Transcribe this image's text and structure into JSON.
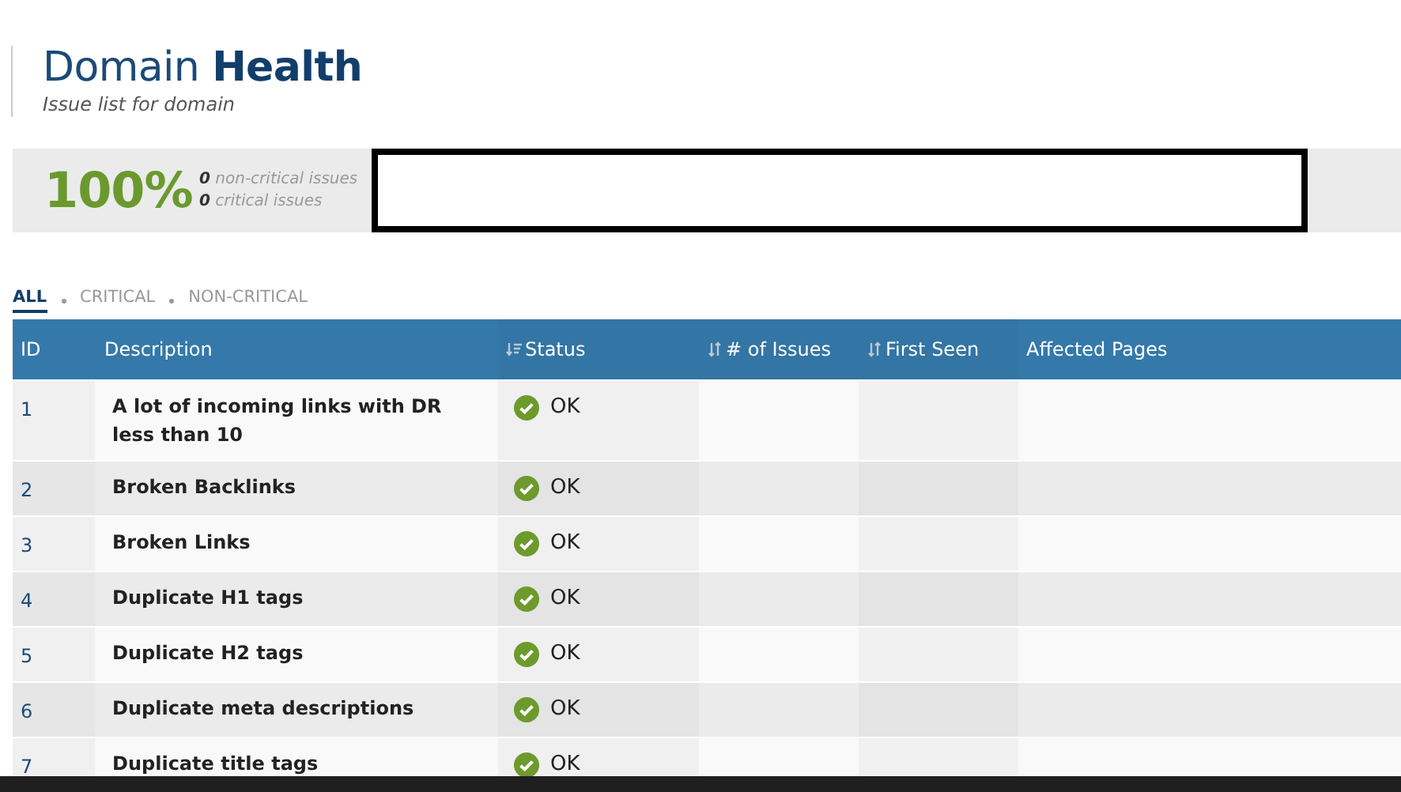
{
  "header": {
    "title_light": "Domain",
    "title_bold": "Health",
    "subtitle": "Issue list for domain"
  },
  "summary": {
    "score": "100%",
    "lines": [
      "**0** non-critical issues",
      "**0** critical issues"
    ]
  },
  "tabs": [
    {
      "label": "ALL",
      "selected": true
    },
    {
      "label": "CRITICAL",
      "selected": false
    },
    {
      "label": "NON-CRITICAL",
      "selected": false
    }
  ],
  "table": {
    "columns": [
      {
        "label": "ID",
        "kind": "plain"
      },
      {
        "label": "Description",
        "kind": "plain"
      },
      {
        "label": "Status",
        "kind": "sorted"
      },
      {
        "label": "# of Issues",
        "kind": "sortable"
      },
      {
        "label": "First Seen",
        "kind": "sortable"
      },
      {
        "label": "Affected Pages",
        "kind": "plain"
      }
    ],
    "rows": [
      {
        "id": "1",
        "description": "A lot of incoming links with DR less than 10",
        "status": {
          "kind": "ok",
          "label": "OK"
        }
      },
      {
        "id": "2",
        "description": "Broken Backlinks",
        "status": {
          "kind": "ok",
          "label": "OK"
        }
      },
      {
        "id": "3",
        "description": "Broken Links",
        "status": {
          "kind": "ok",
          "label": "OK"
        }
      },
      {
        "id": "4",
        "description": "Duplicate H1 tags",
        "status": {
          "kind": "ok",
          "label": "OK"
        }
      },
      {
        "id": "5",
        "description": "Duplicate H2 tags",
        "status": {
          "kind": "ok",
          "label": "OK"
        }
      },
      {
        "id": "6",
        "description": "Duplicate meta descriptions",
        "status": {
          "kind": "ok",
          "label": "OK"
        }
      },
      {
        "id": "7",
        "description": "Duplicate title tags",
        "status": {
          "kind": "ok",
          "label": "OK"
        }
      }
    ]
  }
}
